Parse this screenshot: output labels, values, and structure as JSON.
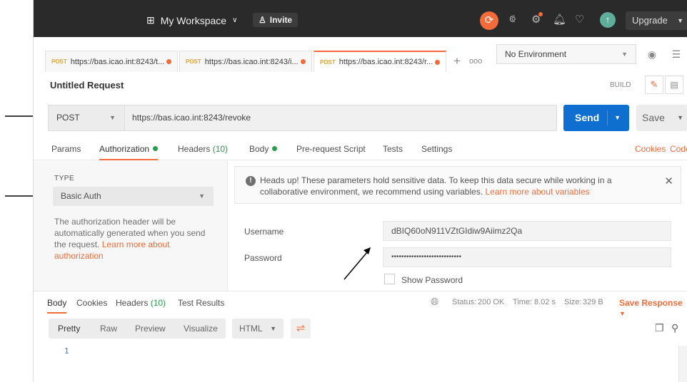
{
  "topbar": {
    "workspace": "My Workspace",
    "invite": "Invite",
    "upgrade": "Upgrade"
  },
  "tabs": [
    {
      "method": "POST",
      "url": "https://bas.icao.int:8243/t..."
    },
    {
      "method": "POST",
      "url": "https://bas.icao.int:8243/i..."
    },
    {
      "method": "POST",
      "url": "https://bas.icao.int:8243/r..."
    }
  ],
  "tab_more": "ooo",
  "environment": "No Environment",
  "request": {
    "name": "Untitled Request",
    "build": "BUILD",
    "method": "POST",
    "url": "https://bas.icao.int:8243/revoke",
    "send": "Send",
    "save": "Save"
  },
  "request_tabs": {
    "params": "Params",
    "authorization": "Authorization",
    "headers": "Headers",
    "headers_count": "(10)",
    "body": "Body",
    "prerequest": "Pre-request Script",
    "tests": "Tests",
    "settings": "Settings",
    "cookies": "Cookies",
    "code": "Code"
  },
  "auth": {
    "type_label": "TYPE",
    "type_value": "Basic Auth",
    "description": "The authorization header will be automatically generated when you send the request. ",
    "learn_more": "Learn more about authorization"
  },
  "alert": {
    "text": "Heads up! These parameters hold sensitive data. To keep this data secure while working in a collaborative environment, we recommend using variables. ",
    "link": "Learn more about variables"
  },
  "fields": {
    "username_label": "Username",
    "username_value": "dBIQ60oN911VZtGIdiw9Aiimz2Qa",
    "password_label": "Password",
    "password_value": "••••••••••••••••••••••••••••",
    "show_password": "Show Password"
  },
  "response": {
    "tabs": {
      "body": "Body",
      "cookies": "Cookies",
      "headers": "Headers",
      "headers_count": "(10)",
      "test_results": "Test Results"
    },
    "status_label": "Status:",
    "status_value": "200 OK",
    "time_label": "Time:",
    "time_value": "8.02 s",
    "size_label": "Size:",
    "size_value": "329 B",
    "save_response": "Save Response",
    "views": {
      "pretty": "Pretty",
      "raw": "Raw",
      "preview": "Preview",
      "visualize": "Visualize"
    },
    "format": "HTML",
    "line_number": "1"
  },
  "colors": {
    "accent": "#f26b3a",
    "send": "#0f6fd0",
    "green": "#2a9d4c",
    "topbar": "#2a2a2a"
  }
}
